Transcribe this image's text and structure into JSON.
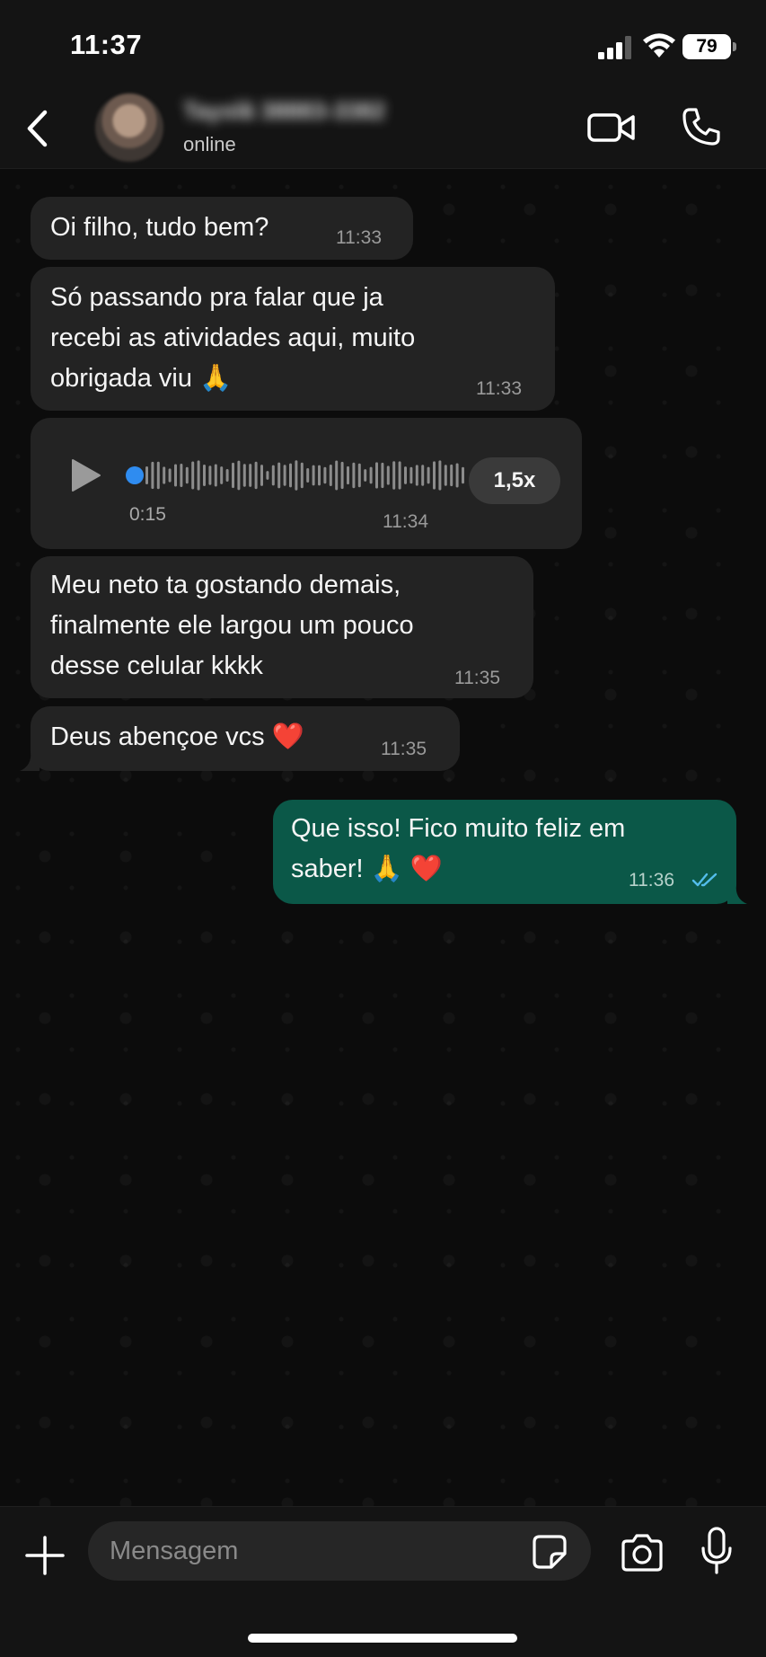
{
  "status_bar": {
    "time": "11:37",
    "battery": "79"
  },
  "header": {
    "contact_name": "Tayslã 38883-3382",
    "status": "online"
  },
  "messages": [
    {
      "direction": "in",
      "text": "Oi filho, tudo bem?",
      "time": "11:33"
    },
    {
      "direction": "in",
      "lines": [
        "Só passando pra falar que ja",
        "recebi as atividades aqui, muito",
        "obrigada viu 🙏"
      ],
      "time": "11:33"
    },
    {
      "direction": "in",
      "type": "voice",
      "duration": "0:15",
      "speed": "1,5x",
      "time": "11:34"
    },
    {
      "direction": "in",
      "lines": [
        "Meu neto ta gostando demais,",
        "finalmente ele largou um pouco",
        "desse celular kkkk"
      ],
      "time": "11:35"
    },
    {
      "direction": "in",
      "text": "Deus abençoe vcs ❤️",
      "time": "11:35"
    },
    {
      "direction": "out",
      "lines": [
        "Que isso! Fico muito feliz em",
        "saber! 🙏 ❤️"
      ],
      "time": "11:36",
      "status": "read"
    }
  ],
  "input": {
    "placeholder": "Mensagem"
  },
  "colors": {
    "incoming_bubble": "#232323",
    "outgoing_bubble": "#0b5848",
    "read_ticks": "#53bdeb",
    "voice_dot": "#2f8cf0"
  },
  "icons": [
    "back-icon",
    "video-call-icon",
    "phone-icon",
    "play-icon",
    "plus-icon",
    "sticker-icon",
    "camera-icon",
    "microphone-icon"
  ]
}
